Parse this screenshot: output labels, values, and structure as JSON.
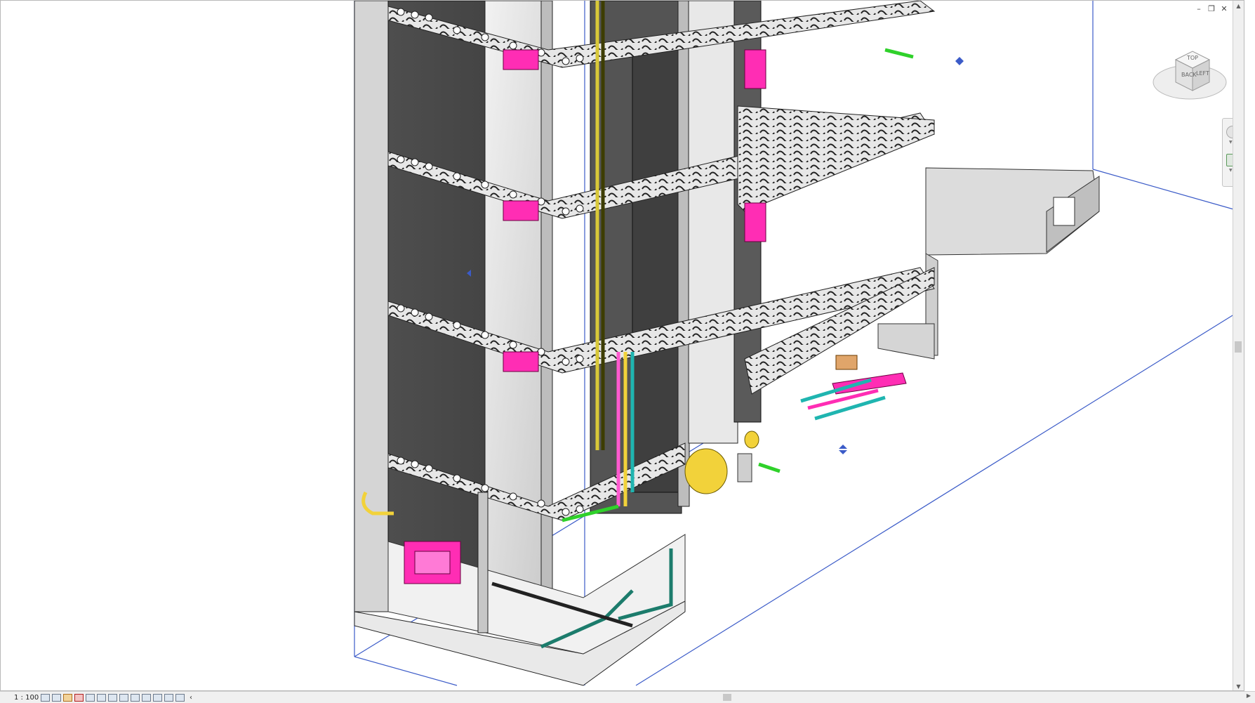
{
  "view": {
    "scale": "1 : 100",
    "viewcube_faces": [
      "BACK",
      "LEFT",
      "TOP"
    ]
  },
  "window_controls": [
    "–",
    "❐",
    "✕"
  ],
  "status_icons": [
    "detail-level-icon",
    "visual-style-icon",
    "sun-path-icon",
    "shadows-icon",
    "render-icon",
    "crop-view-icon",
    "show-crop-icon",
    "lock-3d-icon",
    "temp-hide-icon",
    "reveal-hidden-icon",
    "analytical-icon",
    "highlight-displacement-icon",
    "constraints-icon",
    "more-icon"
  ],
  "colors": {
    "section_box": "#3b5bc8",
    "concrete": "#d8d8d8",
    "wall_dark": "#4a4a4a",
    "duct_magenta": "#ff2db4",
    "pipe_yellow": "#f2d23a",
    "pipe_cyan": "#1fb5b0",
    "pipe_green": "#2fd12a"
  }
}
